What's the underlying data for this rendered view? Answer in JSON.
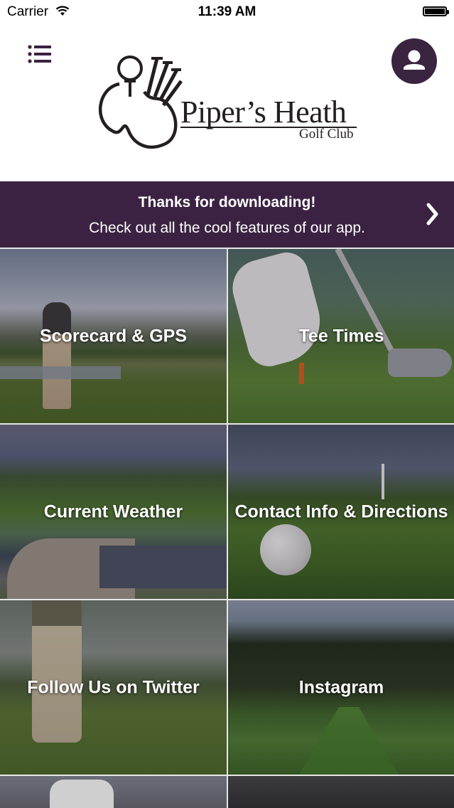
{
  "status_bar": {
    "carrier": "Carrier",
    "time": "11:39 AM"
  },
  "header": {
    "logo_name": "Piper’s Heath",
    "logo_sub": "Golf Club"
  },
  "banner": {
    "title": "Thanks for downloading!",
    "subtitle": "Check out all the cool features of our app."
  },
  "tiles": [
    {
      "label": "Scorecard & GPS"
    },
    {
      "label": "Tee Times"
    },
    {
      "label": "Current Weather"
    },
    {
      "label": "Contact Info & Directions"
    },
    {
      "label": "Follow Us on Twitter"
    },
    {
      "label": "Instagram"
    }
  ],
  "colors": {
    "brand": "#3b2242",
    "profile_button": "#3a2440",
    "tile_text": "#ffffff"
  }
}
